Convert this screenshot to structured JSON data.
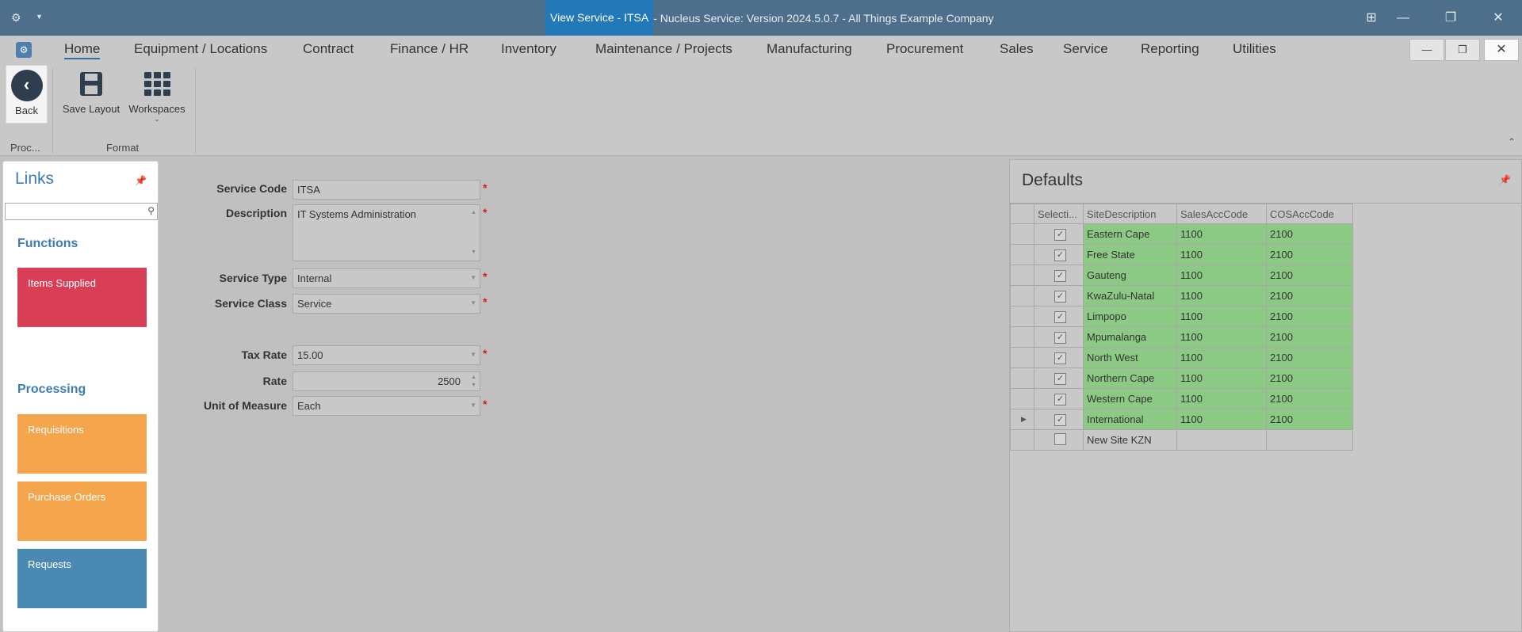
{
  "titlebar": {
    "app_icon": "gear-icon",
    "active_title": "View Service - ITSA",
    "rest_title": " - Nucleus Service: Version 2024.5.0.7 - All Things Example Company"
  },
  "menu": {
    "tabs": [
      "Home",
      "Equipment / Locations",
      "Contract",
      "Finance / HR",
      "Inventory",
      "Maintenance / Projects",
      "Manufacturing",
      "Procurement",
      "Sales",
      "Service",
      "Reporting",
      "Utilities"
    ],
    "active_tab": "Home"
  },
  "ribbon": {
    "back_label": "Back",
    "save_layout_label": "Save Layout",
    "workspaces_label": "Workspaces",
    "group_process": "Proc...",
    "group_format": "Format"
  },
  "links": {
    "title": "Links",
    "search_placeholder": "",
    "functions_heading": "Functions",
    "processing_heading": "Processing",
    "tiles": [
      {
        "label": "Items Supplied",
        "color": "#d83f57"
      },
      {
        "label": "Requisitions",
        "color": "#f5a54b"
      },
      {
        "label": "Purchase Orders",
        "color": "#f5a54b"
      },
      {
        "label": "Requests",
        "color": "#4a8ab2"
      }
    ]
  },
  "form": {
    "service_code": {
      "label": "Service Code",
      "value": "ITSA"
    },
    "description": {
      "label": "Description",
      "value": "IT Systems Administration"
    },
    "service_type": {
      "label": "Service Type",
      "value": "Internal"
    },
    "service_class": {
      "label": "Service Class",
      "value": "Service"
    },
    "tax_rate": {
      "label": "Tax Rate",
      "value": "15.00"
    },
    "rate": {
      "label": "Rate",
      "value": "2500"
    },
    "unit_of_measure": {
      "label": "Unit of Measure",
      "value": "Each"
    },
    "required_marker": "*"
  },
  "defaults": {
    "title": "Defaults",
    "columns": [
      "Selecti...",
      "SiteDescription",
      "SalesAccCode",
      "COSAccCode"
    ],
    "rows": [
      {
        "selected": true,
        "site": "Eastern Cape",
        "sales": "1100",
        "cos": "2100"
      },
      {
        "selected": true,
        "site": "Free State",
        "sales": "1100",
        "cos": "2100"
      },
      {
        "selected": true,
        "site": "Gauteng",
        "sales": "1100",
        "cos": "2100"
      },
      {
        "selected": true,
        "site": "KwaZulu-Natal",
        "sales": "1100",
        "cos": "2100"
      },
      {
        "selected": true,
        "site": "Limpopo",
        "sales": "1100",
        "cos": "2100"
      },
      {
        "selected": true,
        "site": "Mpumalanga",
        "sales": "1100",
        "cos": "2100"
      },
      {
        "selected": true,
        "site": "North West",
        "sales": "1100",
        "cos": "2100"
      },
      {
        "selected": true,
        "site": "Northern Cape",
        "sales": "1100",
        "cos": "2100"
      },
      {
        "selected": true,
        "site": "Western Cape",
        "sales": "1100",
        "cos": "2100"
      },
      {
        "selected": true,
        "site": "International",
        "sales": "1100",
        "cos": "2100",
        "current": true
      },
      {
        "selected": false,
        "site": "New Site KZN",
        "sales": "",
        "cos": ""
      }
    ]
  }
}
